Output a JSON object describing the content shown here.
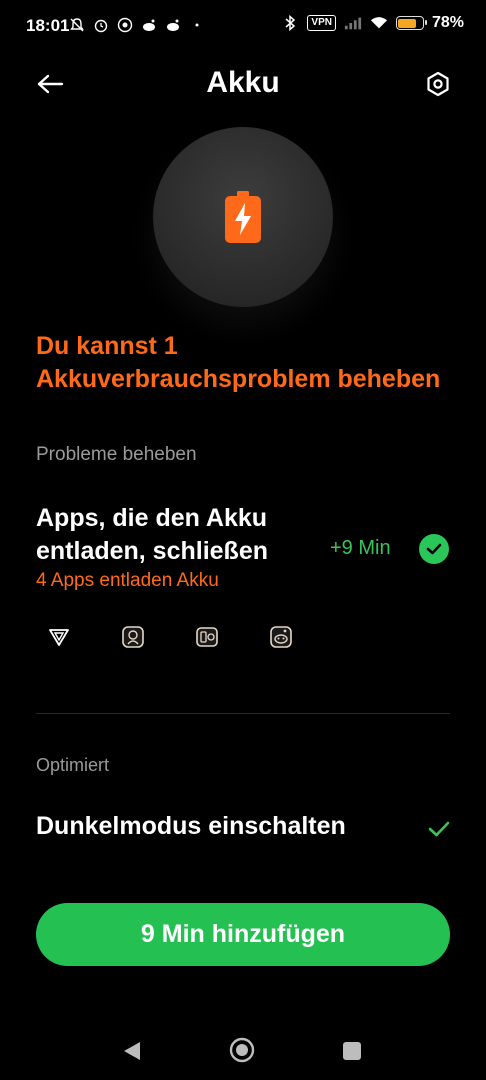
{
  "status_bar": {
    "time": "18:01",
    "vpn": "VPN",
    "battery_percent": "78%",
    "battery_level": 0.78
  },
  "header": {
    "title": "Akku"
  },
  "headline": "Du kannst 1 Akkuverbrauchsproblem beheben",
  "problems_section": {
    "label": "Probleme beheben",
    "item_title": "Apps, die den Akku entladen, schließen",
    "item_subtitle": "4 Apps entladen Akku",
    "gain": "+9 Min"
  },
  "optimized_section": {
    "label": "Optimiert",
    "item_title": "Dunkelmodus einschalten"
  },
  "cta": {
    "label": "9 Min  hinzufügen"
  },
  "colors": {
    "accent_orange": "#ff6a1a",
    "accent_green": "#25c052",
    "background": "#000000"
  }
}
